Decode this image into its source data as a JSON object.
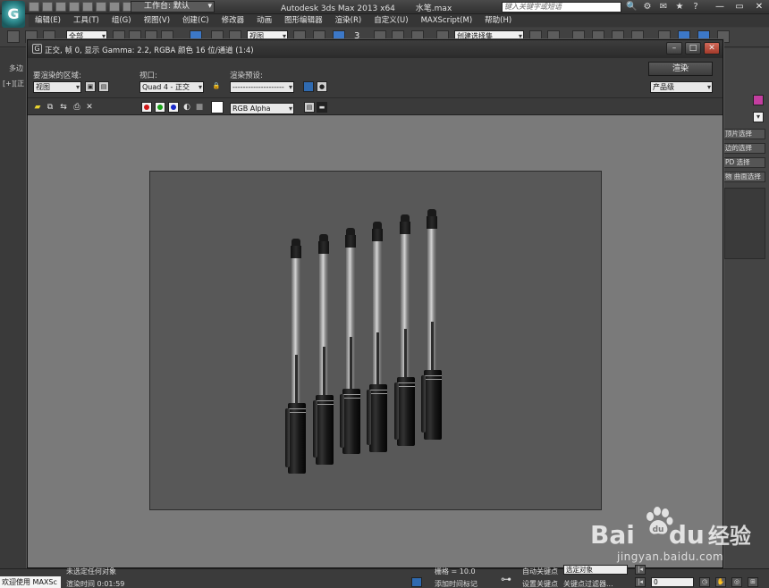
{
  "titlebar": {
    "workspace": "工作台: 默认",
    "app_title": "Autodesk 3ds Max  2013 x64",
    "file_name": "水笔.max",
    "search_placeholder": "键入关键字或短语",
    "window_buttons": [
      "—",
      "▭",
      "✕"
    ]
  },
  "menubar": {
    "items": [
      "编辑(E)",
      "工具(T)",
      "组(G)",
      "视图(V)",
      "创建(C)",
      "修改器",
      "动画",
      "图形编辑器",
      "渲染(R)",
      "自定义(U)",
      "MAXScript(M)",
      "帮助(H)"
    ]
  },
  "toolbar": {
    "selection_filter": "全部",
    "ref_coord": "视图",
    "named_selection": "创建选择集",
    "snap_value": "3"
  },
  "left_panel": {
    "tab_label": "多边",
    "viewport_label": "[+][正"
  },
  "right_panel": {
    "rows": [
      "顶片选择",
      "边的选择",
      "PD 选择",
      "物 曲面选择"
    ]
  },
  "render_frame": {
    "title": "正交, 帧 0, 显示 Gamma: 2.2, RGBA 颜色 16 位/通道 (1:4)",
    "area_label": "要渲染的区域:",
    "area_value": "视图",
    "viewport_label": "视口:",
    "viewport_value": "Quad 4 - 正交",
    "preset_label": "渲染预设:",
    "preset_value": "--------------------",
    "render_button": "渲染",
    "quality_value": "产品级",
    "channel_value": "RGB Alpha",
    "colors": {
      "red": "#d01818",
      "green": "#18a018",
      "blue": "#1828c8"
    }
  },
  "statusbar": {
    "welcome": "欢迎使用 MAXSc",
    "prompt_top": "未选定任何对象",
    "render_time": "渲染时间 0:01:59",
    "grid": "栅格 = 10.0",
    "auto_key": "自动关键点",
    "selected_dropdown": "选定对象",
    "set_key": "设置关键点",
    "key_filter": "关键点过滤器...",
    "add_time_tag": "添加时间标记",
    "frame_value": "0"
  },
  "watermark": {
    "brand": "Bai",
    "brand_suffix": "du",
    "brand_cn": "经验",
    "url": "jingyan.baidu.com"
  }
}
